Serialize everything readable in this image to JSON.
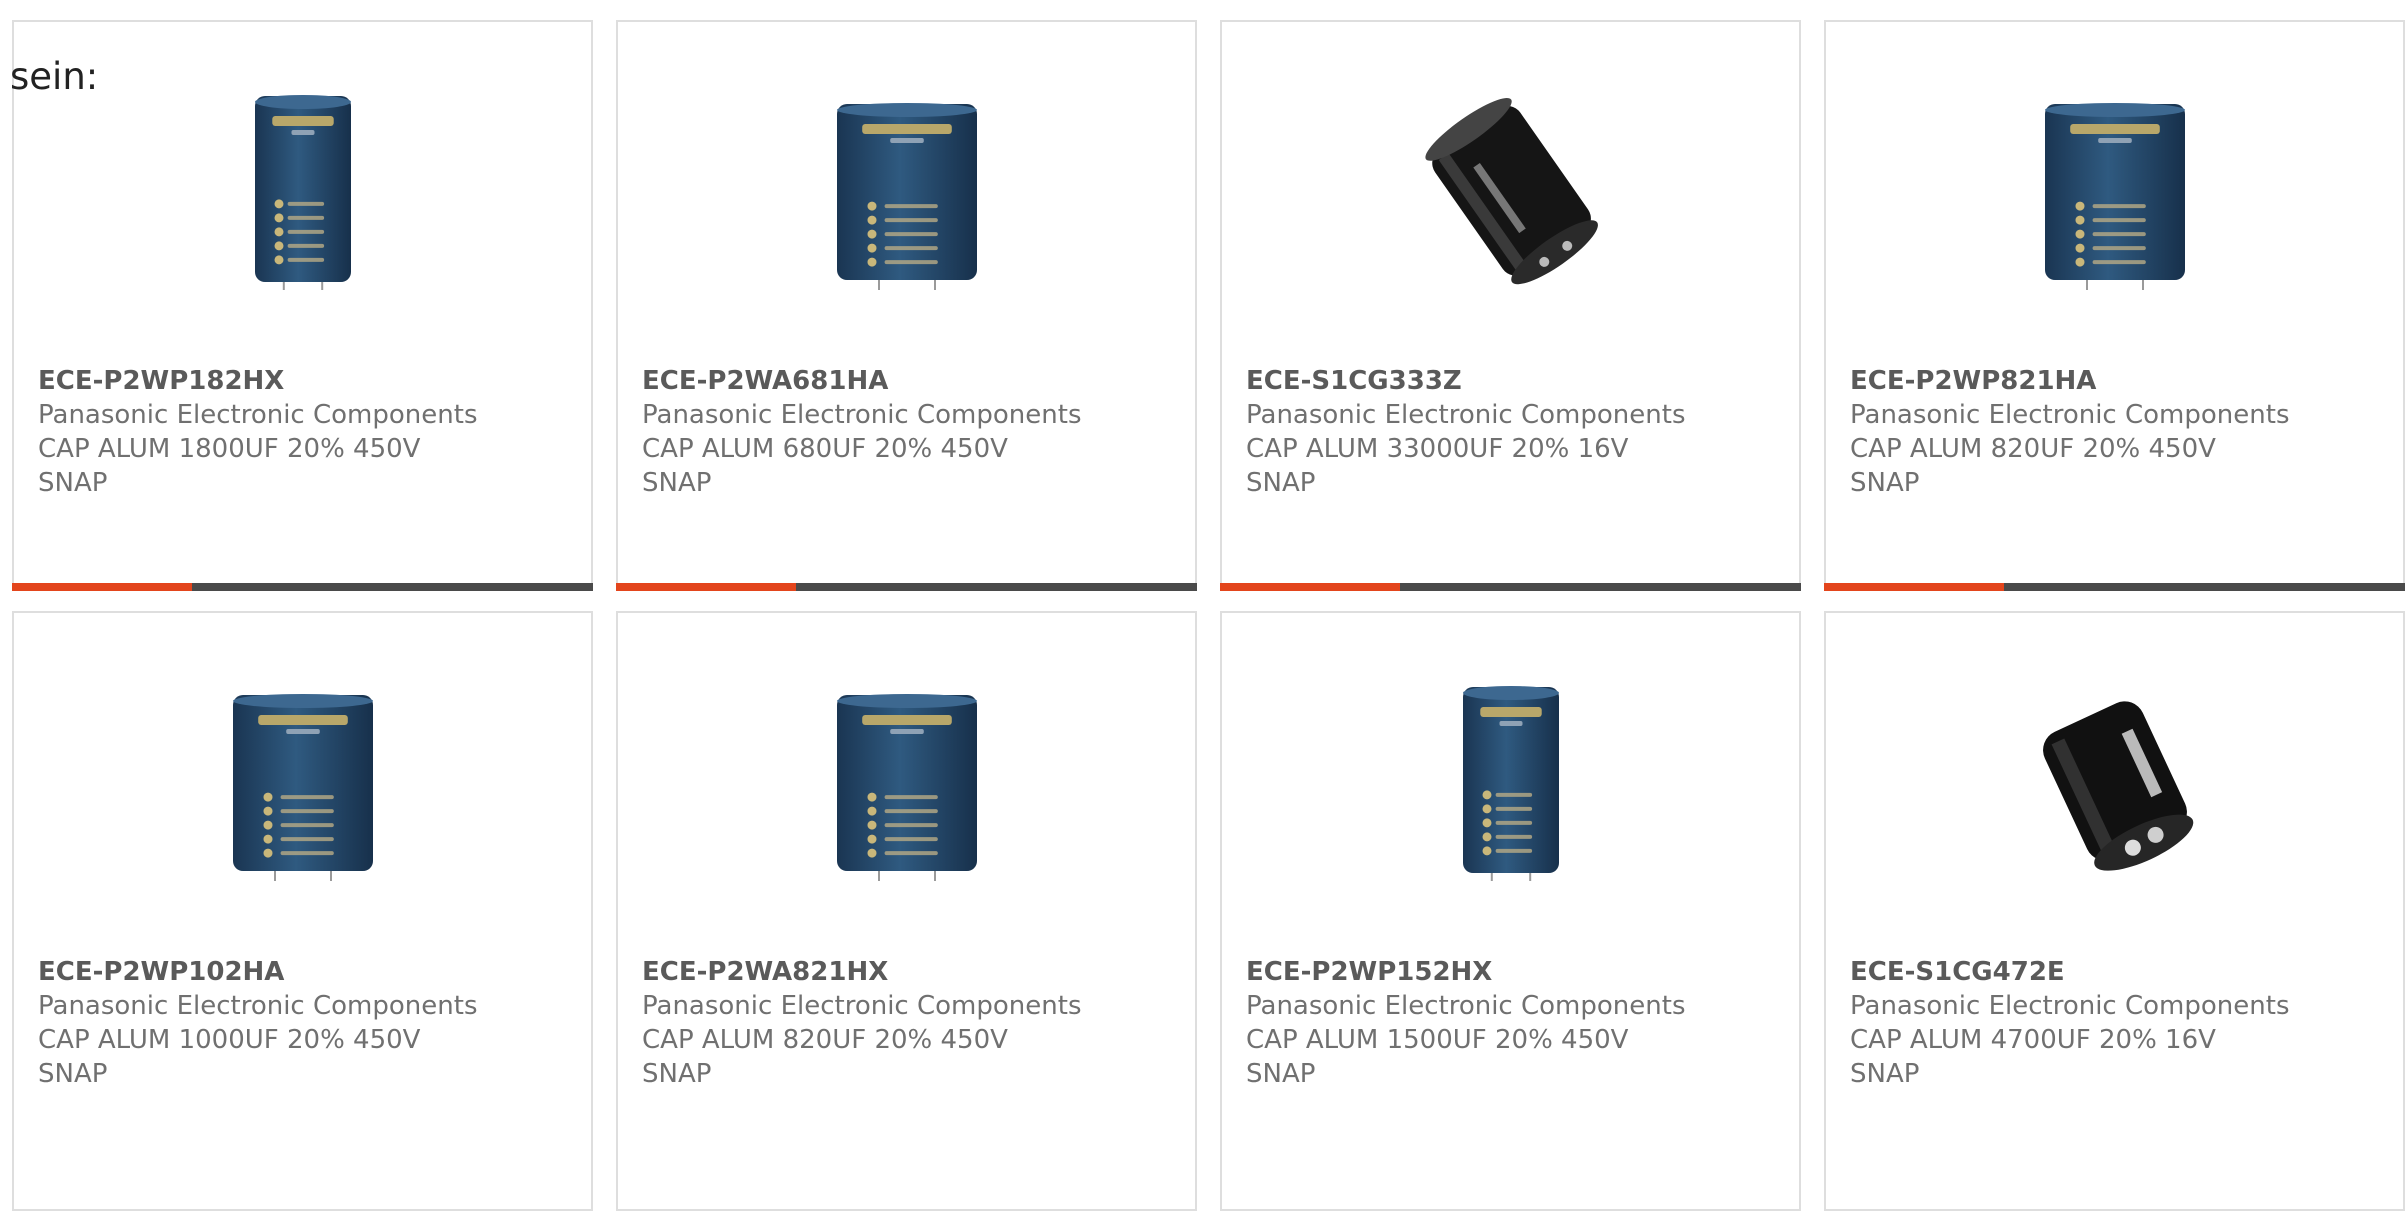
{
  "intro_text": "sein:",
  "accent_color": "#e3451c",
  "bar_track_color": "#4a4a4a",
  "products": [
    {
      "part_number": "ECE-P2WP182HX",
      "manufacturer": "Panasonic Electronic Components",
      "description": "CAP ALUM 1800UF 20% 450V SNAP",
      "image": "blue-snap-capacitor-tall",
      "progress": 0.31
    },
    {
      "part_number": "ECE-P2WA681HA",
      "manufacturer": "Panasonic Electronic Components",
      "description": "CAP ALUM 680UF 20% 450V SNAP",
      "image": "blue-snap-capacitor-squat",
      "progress": 0.31
    },
    {
      "part_number": "ECE-S1CG333Z",
      "manufacturer": "Panasonic Electronic Components",
      "description": "CAP ALUM 33000UF 20% 16V SNAP",
      "image": "black-snap-capacitor-tilted",
      "progress": 0.31
    },
    {
      "part_number": "ECE-P2WP821HA",
      "manufacturer": "Panasonic Electronic Components",
      "description": "CAP ALUM 820UF 20% 450V SNAP",
      "image": "blue-snap-capacitor-squat",
      "progress": 0.31
    },
    {
      "part_number": "ECE-P2WP102HA",
      "manufacturer": "Panasonic Electronic Components",
      "description": "CAP ALUM 1000UF 20% 450V SNAP",
      "image": "blue-snap-capacitor-squat",
      "progress": null
    },
    {
      "part_number": "ECE-P2WA821HX",
      "manufacturer": "Panasonic Electronic Components",
      "description": "CAP ALUM 820UF 20% 450V SNAP",
      "image": "blue-snap-capacitor-squat",
      "progress": null
    },
    {
      "part_number": "ECE-P2WP152HX",
      "manufacturer": "Panasonic Electronic Components",
      "description": "CAP ALUM 1500UF 20% 450V SNAP",
      "image": "blue-snap-capacitor-tall",
      "progress": null
    },
    {
      "part_number": "ECE-S1CG472E",
      "manufacturer": "Panasonic Electronic Components",
      "description": "CAP ALUM 4700UF 20% 16V SNAP",
      "image": "black-radial-capacitor-tilted",
      "progress": null
    }
  ]
}
